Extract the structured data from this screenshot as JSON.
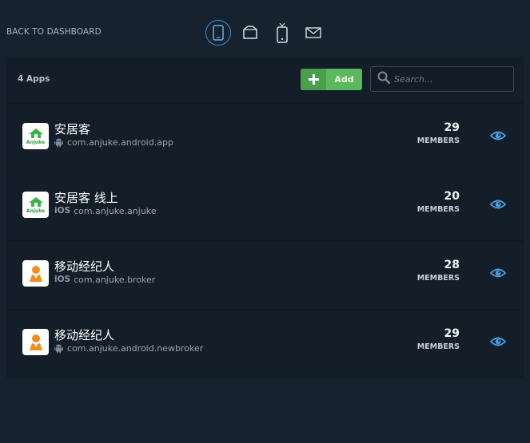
{
  "nav": {
    "back_label": "BACK TO DASHBOARD",
    "icons": [
      "phone-icon",
      "tablet-icon",
      "remote-device-icon",
      "mail-icon"
    ]
  },
  "header": {
    "count_label": "4 Apps",
    "add_label": "Add",
    "search_placeholder": "Search..."
  },
  "apps": [
    {
      "name": "安居客",
      "platform": "android",
      "platform_label": "",
      "bundle_id": "com.anjuke.android.app",
      "members": "29",
      "members_label": "MEMBERS",
      "logo": "anjuke-logo",
      "logo_text": "Anjuke"
    },
    {
      "name": "安居客 线上",
      "platform": "ios",
      "platform_label": "iOS",
      "bundle_id": "com.anjuke.anjuke",
      "members": "20",
      "members_label": "MEMBERS",
      "logo": "anjuke-logo",
      "logo_text": "Anjuke"
    },
    {
      "name": "移动经纪人",
      "platform": "ios",
      "platform_label": "iOS",
      "bundle_id": "com.anjuke.broker",
      "members": "28",
      "members_label": "MEMBERS",
      "logo": "broker-logo",
      "logo_text": ""
    },
    {
      "name": "移动经纪人",
      "platform": "android",
      "platform_label": "",
      "bundle_id": "com.anjuke.android.newbroker",
      "members": "29",
      "members_label": "MEMBERS",
      "logo": "broker-logo",
      "logo_text": ""
    }
  ],
  "colors": {
    "background": "#16222e",
    "panel": "#131e29",
    "accent_blue": "#3f8fd0",
    "add_green": "#5cb85c",
    "eye_blue": "#4a9de0"
  }
}
